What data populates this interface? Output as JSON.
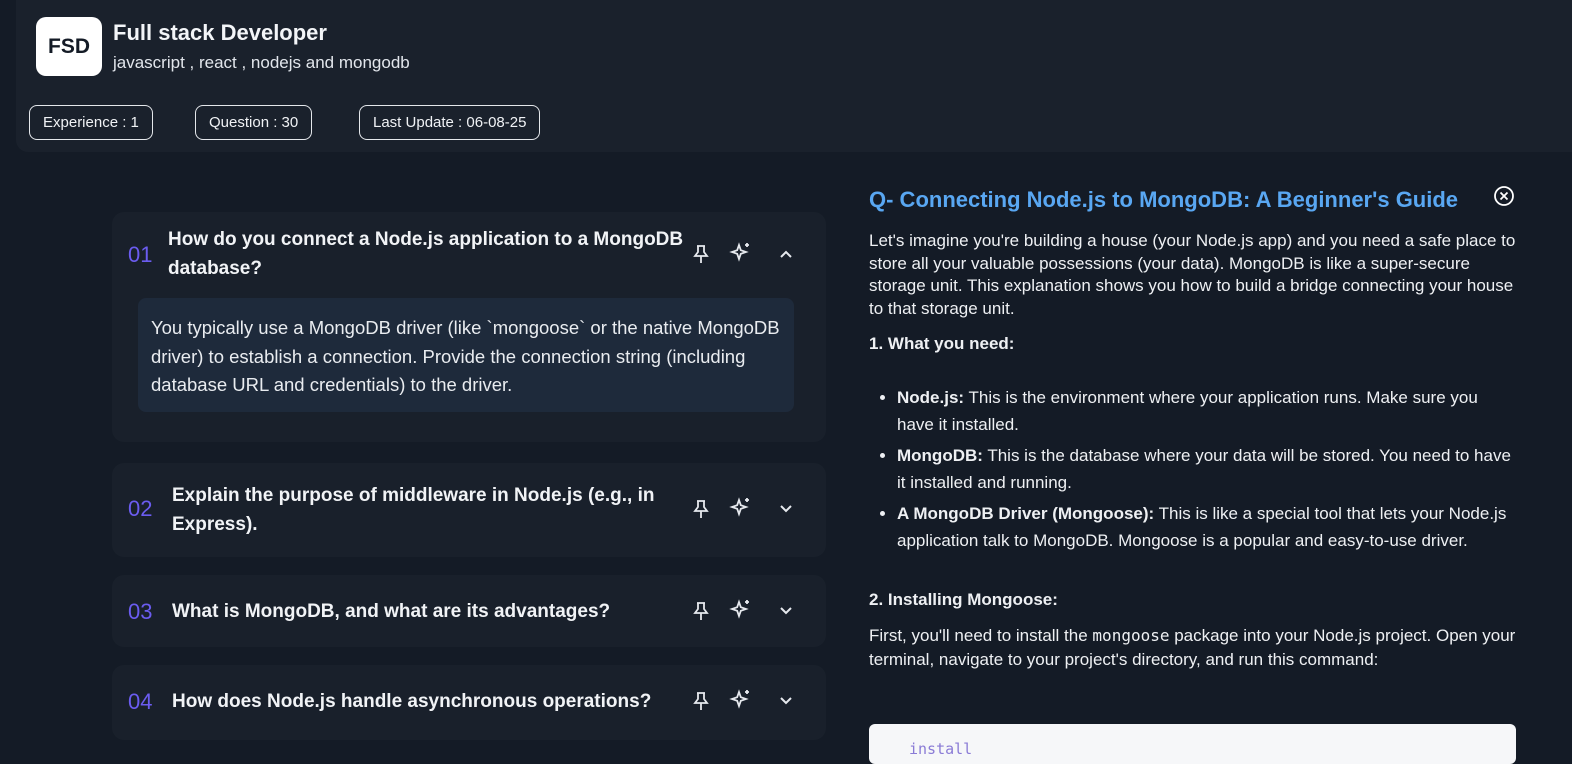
{
  "header": {
    "logo": "FSD",
    "title": "Full stack Developer",
    "subtitle": "javascript , react , nodejs and mongodb",
    "pills": [
      "Experience : 1",
      "Question : 30",
      "Last Update : 06-08-25"
    ]
  },
  "questions": [
    {
      "num": "01",
      "text": "How do you connect a Node.js application to a MongoDB database?",
      "answer": "You typically use a MongoDB driver (like `mongoose` or the native MongoDB driver) to establish a connection. Provide the connection string (including database URL and credentials) to the driver.",
      "expanded": true
    },
    {
      "num": "02",
      "text": "Explain the purpose of middleware in Node.js (e.g., in Express).",
      "expanded": false
    },
    {
      "num": "03",
      "text": "What is MongoDB, and what are its advantages?",
      "expanded": false
    },
    {
      "num": "04",
      "text": "How does Node.js handle asynchronous operations?",
      "expanded": false
    }
  ],
  "icons": {
    "pin": "pin-icon",
    "ai": "sparkles-icon",
    "chevron_up": "chevron-up-icon",
    "chevron_down": "chevron-down-icon",
    "close": "close-circle-icon"
  },
  "detail": {
    "title": "Q- Connecting Node.js to MongoDB: A Beginner's Guide",
    "intro": "Let's imagine you're building a house (your Node.js app) and you need a safe place to store all your valuable possessions (your data). MongoDB is like a super-secure storage unit. This explanation shows you how to build a bridge connecting your house to that storage unit.",
    "section1": "1. What you need:",
    "needs": [
      {
        "term": "Node.js:",
        "desc": " This is the environment where your application runs. Make sure you have it installed."
      },
      {
        "term": "MongoDB:",
        "desc": " This is the database where your data will be stored. You need to have it installed and running."
      },
      {
        "term": "A MongoDB Driver (Mongoose):",
        "desc": " This is like a special tool that lets your Node.js application talk to MongoDB. Mongoose is a popular and easy-to-use driver."
      }
    ],
    "section2": "2. Installing Mongoose:",
    "install_pre": "First, you'll need to install the ",
    "install_code": "mongoose",
    "install_post": " package into your Node.js project. Open your terminal, navigate to your project's directory, and run this command:",
    "code_snippet": "install"
  },
  "colors": {
    "accent_number": "#6b5cf0",
    "detail_title": "#59a7f2",
    "background": "#141b26"
  }
}
